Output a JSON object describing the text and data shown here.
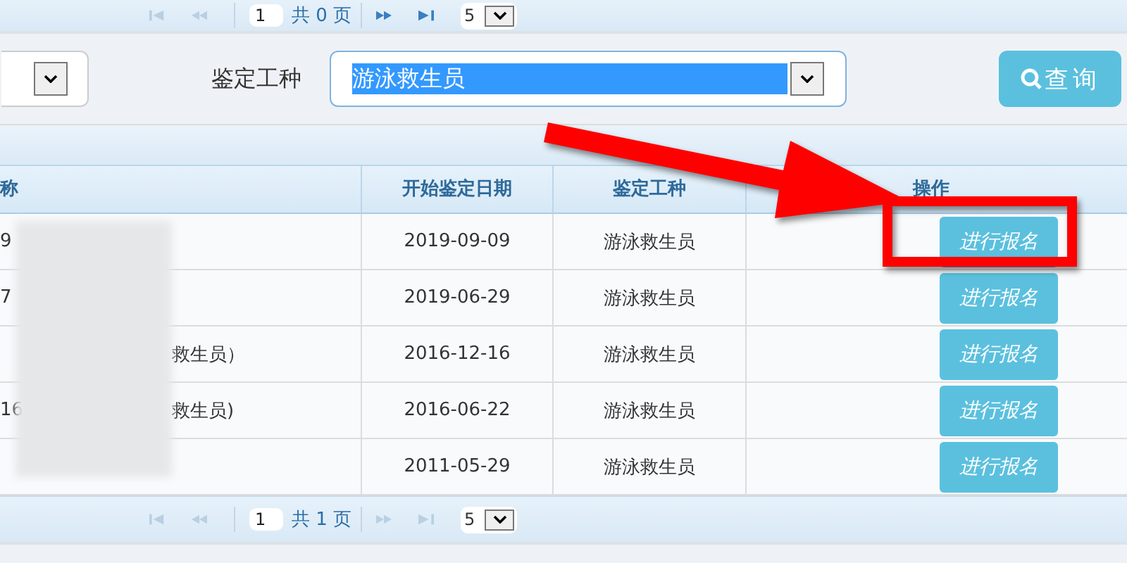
{
  "top_pager": {
    "page": "1",
    "total": "共 0 页",
    "page_size": "5",
    "back_disabled": true,
    "forward_disabled": false
  },
  "filter": {
    "label": "鉴定工种",
    "value": "游泳救生员",
    "button": "查询"
  },
  "table": {
    "columns": [
      {
        "label": "称"
      },
      {
        "label": "开始鉴定日期"
      },
      {
        "label": "鉴定工种"
      },
      {
        "label": "操作"
      }
    ],
    "rows": [
      {
        "name_start": "9",
        "date": "2019-09-09",
        "type": "游泳救生员",
        "action": "进行报名"
      },
      {
        "name_start": "7",
        "date": "2019-06-29",
        "type": "游泳救生员",
        "action": "进行报名"
      },
      {
        "name_end": "救生员）",
        "date": "2016-12-16",
        "type": "游泳救生员",
        "action": "进行报名"
      },
      {
        "name_start": "16",
        "name_end": "救生员)",
        "date": "2016-06-22",
        "type": "游泳救生员",
        "action": "进行报名"
      },
      {
        "date": "2011-05-29",
        "type": "游泳救生员",
        "action": "进行报名"
      }
    ]
  },
  "bottom_pager": {
    "page": "1",
    "total": "共 1 页",
    "page_size": "5",
    "back_disabled": true,
    "forward_disabled": true
  }
}
